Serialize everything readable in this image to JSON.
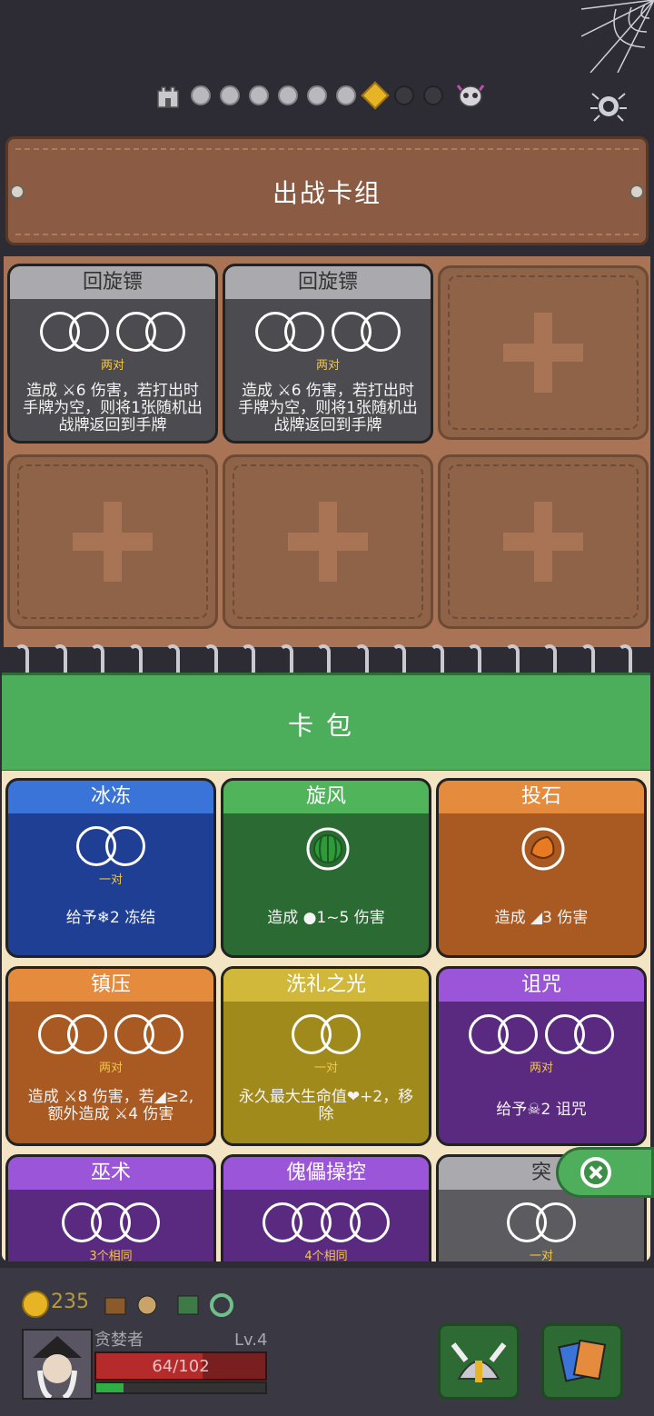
{
  "progress": {
    "steps": 8,
    "current_index": 6
  },
  "deck": {
    "title": "出战卡组",
    "cards": [
      {
        "name": "回旋镖",
        "rings": "两对",
        "desc_line1": "造成 ⚔6 伤害，若打出时",
        "desc_line2": "手牌为空，则将1张随机出",
        "desc_line3": "战牌返回到手牌"
      },
      {
        "name": "回旋镖",
        "rings": "两对",
        "desc_line1": "造成 ⚔6 伤害，若打出时",
        "desc_line2": "手牌为空，则将1张随机出",
        "desc_line3": "战牌返回到手牌"
      }
    ]
  },
  "pack": {
    "title": "卡包",
    "cards": [
      {
        "name": "冰冻",
        "rings": "一对",
        "desc": "给予❄2 冻结",
        "color": "#1f3f95"
      },
      {
        "name": "旋风",
        "rings": "",
        "desc": "造成 ●1~5 伤害",
        "color": "#2b6a33"
      },
      {
        "name": "投石",
        "rings": "",
        "desc": "造成 ◢3 伤害",
        "color": "#a85a22"
      },
      {
        "name": "镇压",
        "rings": "两对",
        "desc_line1": "造成 ⚔8 伤害，若◢≥2,",
        "desc_line2": "额外造成 ⚔4 伤害",
        "color": "#a85a22"
      },
      {
        "name": "洗礼之光",
        "rings": "一对",
        "desc_line1": "永久最大生命值❤+2，移",
        "desc_line2": "除",
        "color": "#a08a1c"
      },
      {
        "name": "诅咒",
        "rings": "两对",
        "desc": "给予☠2 诅咒",
        "color": "#5a2a80"
      },
      {
        "name": "巫术",
        "rings": "3个相同",
        "color": "#5a2a80"
      },
      {
        "name": "傀儡操控",
        "rings": "4个相同",
        "color": "#5a2a80"
      },
      {
        "name": "突",
        "rings": "一对",
        "color": "#5c5c60"
      }
    ]
  },
  "player": {
    "gold": "235",
    "name": "贪婪者",
    "level": "Lv.4",
    "hp_text": "64/102",
    "hp_fraction": 0.63,
    "xp_fraction": 0.16
  }
}
